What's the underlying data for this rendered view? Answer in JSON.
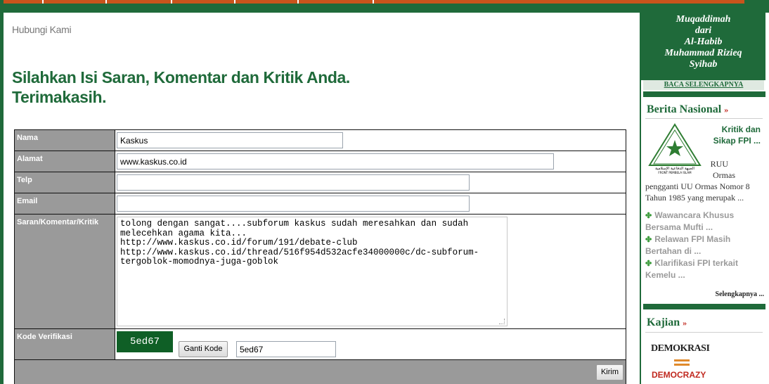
{
  "breadcrumb": "Hubungi Kami",
  "heading": {
    "line1": "Silahkan Isi Saran, Komentar dan Kritik Anda.",
    "line2": "Terimakasih."
  },
  "form": {
    "name_label": "Nama",
    "name_value": "Kaskus",
    "address_label": "Alamat",
    "address_value": "www.kaskus.co.id",
    "phone_label": "Telp",
    "phone_value": "",
    "email_label": "Email",
    "email_value": "",
    "message_label": "Saran/Komentar/Kritik",
    "message_value": "tolong dengan sangat....subforum kaskus sudah meresahkan dan sudah\nmelecehkan agama kita...\nhttp://www.kaskus.co.id/forum/191/debate-club\nhttp://www.kaskus.co.id/thread/516f954d532acfe34000000c/dc-subforum-\ntergoblok-momodnya-juga-goblok",
    "captcha_label": "Kode Verifikasi",
    "captcha_code": "5ed67",
    "refresh_button": "Ganti Kode",
    "captcha_input_value": "5ed67",
    "submit_button": "Kirim"
  },
  "sidebar": {
    "muqaddimah": {
      "line1": "Muqaddimah",
      "line2": "dari",
      "line3": "Al-Habib",
      "line4": "Muhammad Rizieq",
      "line5": "Syihab"
    },
    "read_more": "BACA SELENGKAPNYA",
    "national_news_title": "Berita Nasional",
    "news_item_title": "Kritik dan Sikap FPI ...",
    "news_item_body_ruu": "RUU",
    "news_item_body_ormas": "Ormas",
    "news_item_body_rest": "pengganti UU Ormas Nomor 8 Tahun 1985 yang merupak ...",
    "logo_arabic": "الجبهة الدفاعية الإسلامية",
    "logo_latin": "FRONT PEMBELA ISLAM",
    "related": [
      "Wawancara Khusus Bersama Mufti ...",
      "Relawan FPI Masih Bertahan di ...",
      "Klarifikasi FPI terkait Kemelu ..."
    ],
    "more_link": "Selengkapnya ...",
    "study_title": "Kajian",
    "study_image_top": "DEMOKRASI",
    "study_image_bottom": "DEMOCRAZY"
  },
  "colors": {
    "brand_green": "#1f6a3a",
    "nav_orange": "#c9541c",
    "label_gray": "#9a9a9a",
    "accent_red": "#c0281e"
  }
}
